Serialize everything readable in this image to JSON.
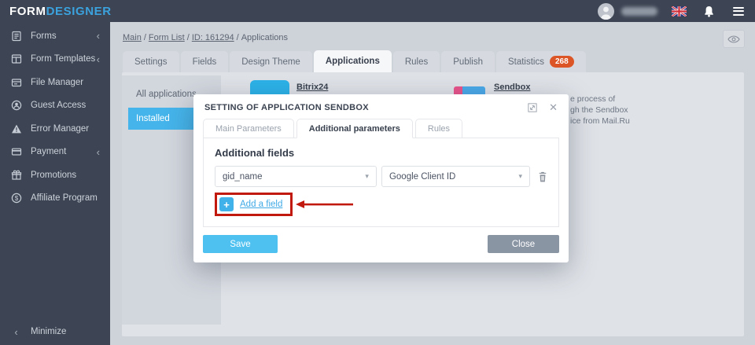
{
  "topbar": {
    "logo_primary": "FORM",
    "logo_secondary": "DESIGNER"
  },
  "glyphs": {
    "chevron_left": "‹",
    "select_caret": "▾",
    "close": "✕",
    "plus": "+"
  },
  "icons": {
    "avatar": "user-avatar",
    "flag": "uk-flag-icon",
    "bell": "notifications-bell-icon",
    "menu": "hamburger-menu-icon",
    "eye": "preview-eye-icon",
    "trash": "trash-icon",
    "expand": "expand-modal-icon"
  },
  "sidebar": {
    "items": [
      {
        "label": "Forms",
        "icon": "forms-icon",
        "has_submenu": true
      },
      {
        "label": "Form Templates",
        "icon": "form-templates-icon",
        "has_submenu": true
      },
      {
        "label": "File Manager",
        "icon": "file-manager-icon",
        "has_submenu": false
      },
      {
        "label": "Guest Access",
        "icon": "guest-access-icon",
        "has_submenu": false
      },
      {
        "label": "Error Manager",
        "icon": "error-manager-icon",
        "has_submenu": false
      },
      {
        "label": "Payment",
        "icon": "payment-icon",
        "has_submenu": true
      },
      {
        "label": "Promotions",
        "icon": "promotions-icon",
        "has_submenu": false
      },
      {
        "label": "Affiliate Program",
        "icon": "affiliate-program-icon",
        "has_submenu": false
      }
    ],
    "minimize_label": "Minimize"
  },
  "breadcrumb": {
    "separator": "/",
    "links": [
      {
        "label": "Main"
      },
      {
        "label": "Form List"
      },
      {
        "label": "ID: 161294"
      }
    ],
    "current": "Applications"
  },
  "tabs": {
    "items": [
      {
        "label": "Settings"
      },
      {
        "label": "Fields"
      },
      {
        "label": "Design Theme"
      },
      {
        "label": "Applications",
        "active": true
      },
      {
        "label": "Rules"
      },
      {
        "label": "Publish"
      },
      {
        "label": "Statistics",
        "badge": "268"
      }
    ]
  },
  "applications_panel": {
    "filters": [
      {
        "label": "All applications"
      },
      {
        "label": "Installed",
        "active": true
      }
    ]
  },
  "applications": {
    "bitrix": {
      "name": "Bitrix24"
    },
    "sendbox": {
      "name": "Sendbox",
      "description_fragments": [
        "e process of",
        "gh the Sendbox",
        "ice from Mail.Ru"
      ]
    }
  },
  "modal": {
    "title": "SETTING OF APPLICATION SENDBOX",
    "tabs": [
      {
        "label": "Main Parameters"
      },
      {
        "label": "Additional parameters",
        "active": true
      },
      {
        "label": "Rules"
      }
    ],
    "section_title": "Additional fields",
    "field_row": {
      "field_value": "gid_name",
      "param_value": "Google Client ID"
    },
    "add_field_label": "Add a field",
    "buttons": {
      "save": "Save",
      "close": "Close"
    }
  },
  "colors": {
    "sidebar_dark": "#3d4554",
    "accent_blue": "#45b4ea",
    "save_blue": "#4fc1f0",
    "logo_blue": "#3ba2de",
    "badge_orange": "#dc5526",
    "annotation_red": "#c2190f",
    "link_blue": "#3fa9e6"
  }
}
